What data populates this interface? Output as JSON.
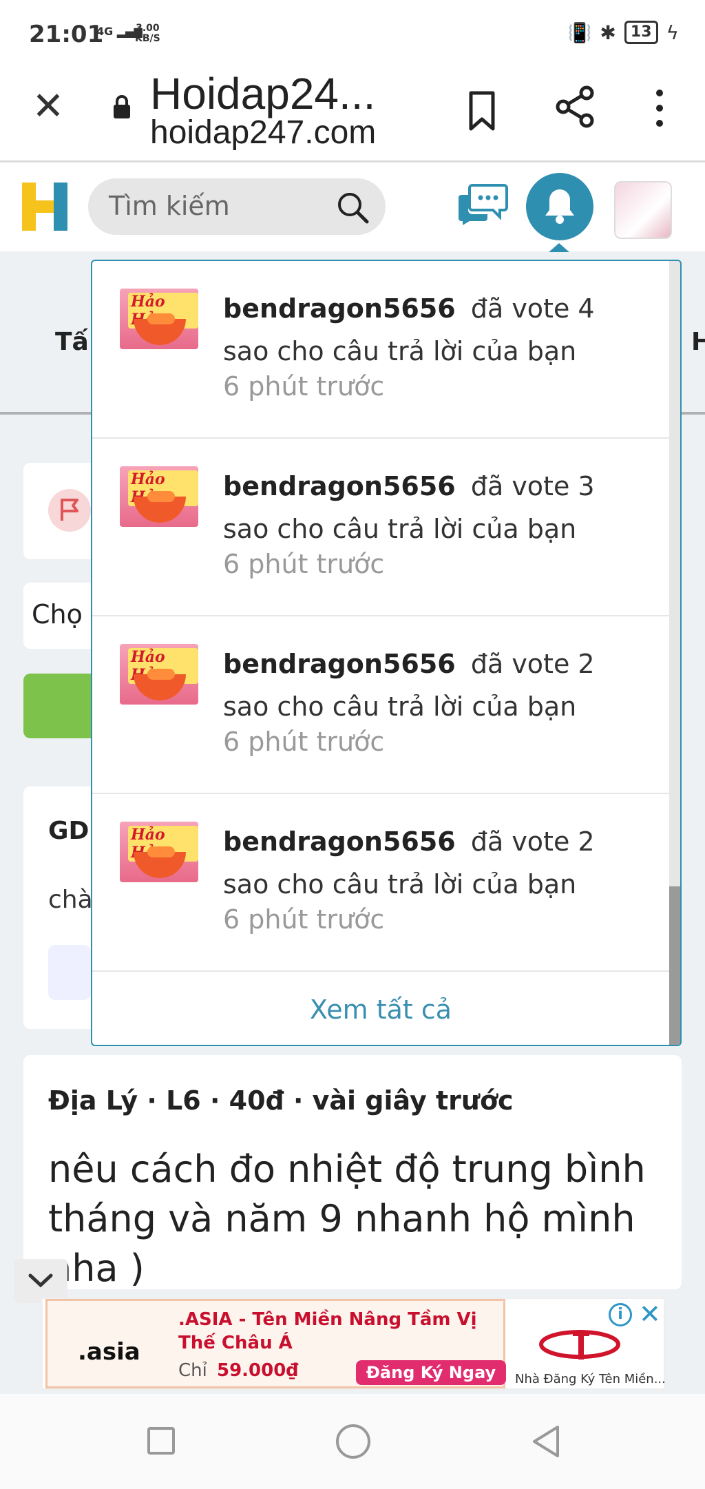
{
  "status_bar": {
    "time": "21:01",
    "network": "4G",
    "speed_value": "3.00",
    "speed_unit": "KB/S",
    "battery": "13"
  },
  "browser": {
    "page_title": "Hoidap24...",
    "url": "hoidap247.com"
  },
  "site_header": {
    "search_placeholder": "Tìm kiếm",
    "accent_color": "#2f8fb0"
  },
  "background_page": {
    "tab_left_partial": "Tấ",
    "tab_right_partial": "H",
    "select_partial": "Chọ",
    "card_title_partial": "GD",
    "card_text_partial": "chà",
    "question": {
      "subject": "Địa Lý",
      "grade": "L6",
      "points": "40đ",
      "time": "vài giây trước",
      "separator": "·",
      "text": "nêu cách đo nhiệt độ trung bình tháng và năm 9 nhanh hộ mình nha )"
    }
  },
  "notifications": {
    "items": [
      {
        "user": "bendragon5656",
        "message": "đã vote 4 sao cho câu trả lời của bạn",
        "time": "6 phút trước"
      },
      {
        "user": "bendragon5656",
        "message": "đã vote 3 sao cho câu trả lời của bạn",
        "time": "6 phút trước"
      },
      {
        "user": "bendragon5656",
        "message": "đã vote 2 sao cho câu trả lời của bạn",
        "time": "6 phút trước"
      },
      {
        "user": "bendragon5656",
        "message": "đã vote 2 sao cho câu trả lời của bạn",
        "time": "6 phút trước"
      }
    ],
    "thumb_brand": "Hảo Hảo",
    "see_all": "Xem tất cả"
  },
  "ad": {
    "logo": ".asia",
    "headline": ".ASIA - Tên Miền Nâng Tầm Vị Thế Châu Á",
    "price_label": "Chỉ",
    "price": "59.000₫",
    "cta": "Đăng Ký Ngay",
    "advertiser": "Nhà Đăng Ký Tên Miền...",
    "info_icon": "i",
    "close_icon": "✕"
  }
}
